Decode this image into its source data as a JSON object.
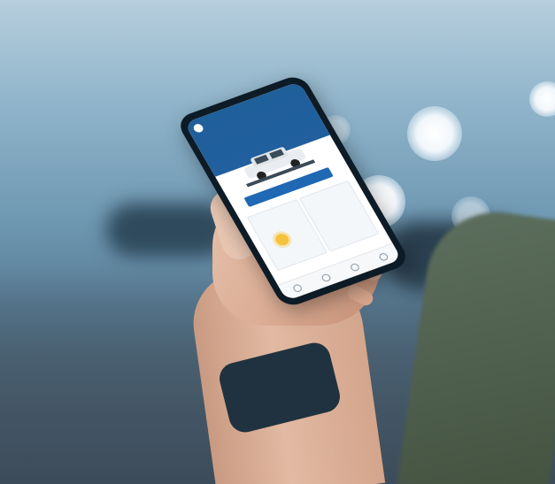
{
  "photo": {
    "description_colors": {
      "sky": "#8fb4ca",
      "road": "#4d6a80",
      "bokeh": "#ffffff",
      "watch_strap": "#20323f",
      "app_header": "#215f9f",
      "app_button": "#1f68b3"
    }
  },
  "phone_app": {
    "header_links": [
      "",
      ""
    ],
    "title": "",
    "description": "",
    "button_label": "",
    "cards": [
      "",
      ""
    ],
    "nav_icons": [
      "home-icon",
      "car-icon",
      "location-icon",
      "account-icon"
    ]
  }
}
